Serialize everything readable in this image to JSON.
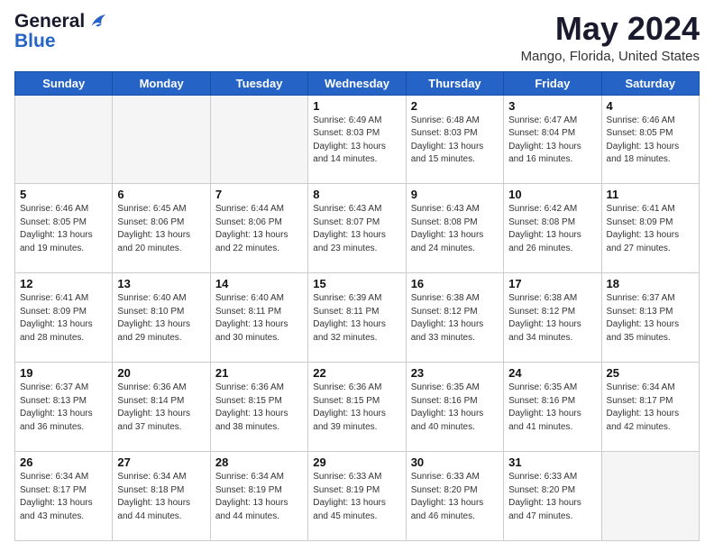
{
  "header": {
    "logo_line1": "General",
    "logo_line2": "Blue",
    "main_title": "May 2024",
    "subtitle": "Mango, Florida, United States"
  },
  "days_of_week": [
    "Sunday",
    "Monday",
    "Tuesday",
    "Wednesday",
    "Thursday",
    "Friday",
    "Saturday"
  ],
  "weeks": [
    [
      {
        "day": "",
        "info": ""
      },
      {
        "day": "",
        "info": ""
      },
      {
        "day": "",
        "info": ""
      },
      {
        "day": "1",
        "info": "Sunrise: 6:49 AM\nSunset: 8:03 PM\nDaylight: 13 hours and 14 minutes."
      },
      {
        "day": "2",
        "info": "Sunrise: 6:48 AM\nSunset: 8:03 PM\nDaylight: 13 hours and 15 minutes."
      },
      {
        "day": "3",
        "info": "Sunrise: 6:47 AM\nSunset: 8:04 PM\nDaylight: 13 hours and 16 minutes."
      },
      {
        "day": "4",
        "info": "Sunrise: 6:46 AM\nSunset: 8:05 PM\nDaylight: 13 hours and 18 minutes."
      }
    ],
    [
      {
        "day": "5",
        "info": "Sunrise: 6:46 AM\nSunset: 8:05 PM\nDaylight: 13 hours and 19 minutes."
      },
      {
        "day": "6",
        "info": "Sunrise: 6:45 AM\nSunset: 8:06 PM\nDaylight: 13 hours and 20 minutes."
      },
      {
        "day": "7",
        "info": "Sunrise: 6:44 AM\nSunset: 8:06 PM\nDaylight: 13 hours and 22 minutes."
      },
      {
        "day": "8",
        "info": "Sunrise: 6:43 AM\nSunset: 8:07 PM\nDaylight: 13 hours and 23 minutes."
      },
      {
        "day": "9",
        "info": "Sunrise: 6:43 AM\nSunset: 8:08 PM\nDaylight: 13 hours and 24 minutes."
      },
      {
        "day": "10",
        "info": "Sunrise: 6:42 AM\nSunset: 8:08 PM\nDaylight: 13 hours and 26 minutes."
      },
      {
        "day": "11",
        "info": "Sunrise: 6:41 AM\nSunset: 8:09 PM\nDaylight: 13 hours and 27 minutes."
      }
    ],
    [
      {
        "day": "12",
        "info": "Sunrise: 6:41 AM\nSunset: 8:09 PM\nDaylight: 13 hours and 28 minutes."
      },
      {
        "day": "13",
        "info": "Sunrise: 6:40 AM\nSunset: 8:10 PM\nDaylight: 13 hours and 29 minutes."
      },
      {
        "day": "14",
        "info": "Sunrise: 6:40 AM\nSunset: 8:11 PM\nDaylight: 13 hours and 30 minutes."
      },
      {
        "day": "15",
        "info": "Sunrise: 6:39 AM\nSunset: 8:11 PM\nDaylight: 13 hours and 32 minutes."
      },
      {
        "day": "16",
        "info": "Sunrise: 6:38 AM\nSunset: 8:12 PM\nDaylight: 13 hours and 33 minutes."
      },
      {
        "day": "17",
        "info": "Sunrise: 6:38 AM\nSunset: 8:12 PM\nDaylight: 13 hours and 34 minutes."
      },
      {
        "day": "18",
        "info": "Sunrise: 6:37 AM\nSunset: 8:13 PM\nDaylight: 13 hours and 35 minutes."
      }
    ],
    [
      {
        "day": "19",
        "info": "Sunrise: 6:37 AM\nSunset: 8:13 PM\nDaylight: 13 hours and 36 minutes."
      },
      {
        "day": "20",
        "info": "Sunrise: 6:36 AM\nSunset: 8:14 PM\nDaylight: 13 hours and 37 minutes."
      },
      {
        "day": "21",
        "info": "Sunrise: 6:36 AM\nSunset: 8:15 PM\nDaylight: 13 hours and 38 minutes."
      },
      {
        "day": "22",
        "info": "Sunrise: 6:36 AM\nSunset: 8:15 PM\nDaylight: 13 hours and 39 minutes."
      },
      {
        "day": "23",
        "info": "Sunrise: 6:35 AM\nSunset: 8:16 PM\nDaylight: 13 hours and 40 minutes."
      },
      {
        "day": "24",
        "info": "Sunrise: 6:35 AM\nSunset: 8:16 PM\nDaylight: 13 hours and 41 minutes."
      },
      {
        "day": "25",
        "info": "Sunrise: 6:34 AM\nSunset: 8:17 PM\nDaylight: 13 hours and 42 minutes."
      }
    ],
    [
      {
        "day": "26",
        "info": "Sunrise: 6:34 AM\nSunset: 8:17 PM\nDaylight: 13 hours and 43 minutes."
      },
      {
        "day": "27",
        "info": "Sunrise: 6:34 AM\nSunset: 8:18 PM\nDaylight: 13 hours and 44 minutes."
      },
      {
        "day": "28",
        "info": "Sunrise: 6:34 AM\nSunset: 8:19 PM\nDaylight: 13 hours and 44 minutes."
      },
      {
        "day": "29",
        "info": "Sunrise: 6:33 AM\nSunset: 8:19 PM\nDaylight: 13 hours and 45 minutes."
      },
      {
        "day": "30",
        "info": "Sunrise: 6:33 AM\nSunset: 8:20 PM\nDaylight: 13 hours and 46 minutes."
      },
      {
        "day": "31",
        "info": "Sunrise: 6:33 AM\nSunset: 8:20 PM\nDaylight: 13 hours and 47 minutes."
      },
      {
        "day": "",
        "info": ""
      }
    ]
  ]
}
